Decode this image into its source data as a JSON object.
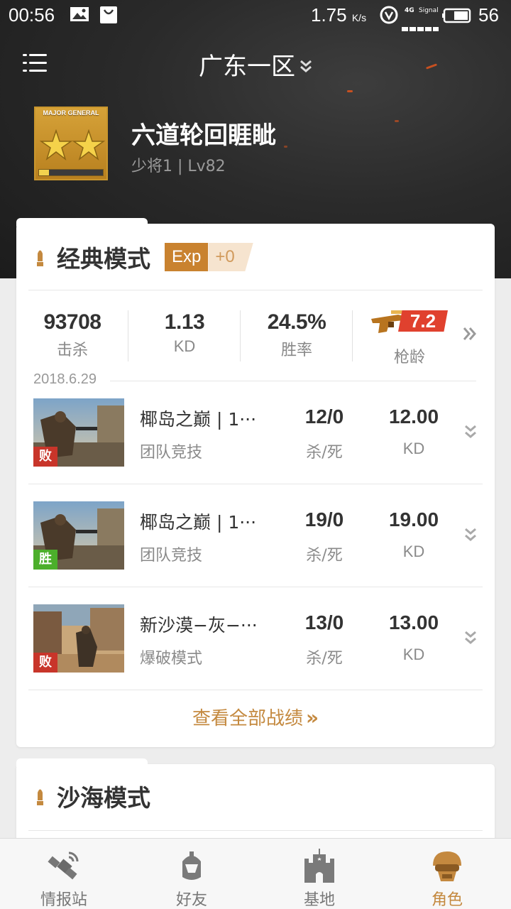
{
  "status_bar": {
    "time": "00:56",
    "net_speed": "1.75",
    "net_speed_unit": "K/s",
    "network_type": "4G",
    "signal_label": "Signal",
    "battery": "56"
  },
  "header": {
    "server": "广东一区",
    "rank_badge_text": "MAJOR GENERAL",
    "rank_progress": 0.15,
    "player_name": "六道轮回睚眦",
    "player_level": "少将1 | Lv82"
  },
  "classic_mode": {
    "title": "经典模式",
    "exp_label": "Exp",
    "exp_value": "+0",
    "stats": [
      {
        "value": "93708",
        "label": "击杀"
      },
      {
        "value": "1.13",
        "label": "KD"
      },
      {
        "value": "24.5%",
        "label": "胜率"
      }
    ],
    "gun_age": {
      "value": "7.2",
      "label": "枪龄"
    },
    "date": "2018.6.29",
    "matches": [
      {
        "map": "椰岛之巅 | 1···",
        "mode": "团队竞技",
        "result": "败",
        "result_type": "lose",
        "kills_deaths": "12/0",
        "kd_label": "杀/死",
        "kd": "12.00",
        "kd_unit": "KD"
      },
      {
        "map": "椰岛之巅 | 1···",
        "mode": "团队竞技",
        "result": "胜",
        "result_type": "win",
        "kills_deaths": "19/0",
        "kd_label": "杀/死",
        "kd": "19.00",
        "kd_unit": "KD"
      },
      {
        "map": "新沙漠−灰−···",
        "mode": "爆破模式",
        "result": "败",
        "result_type": "lose",
        "kills_deaths": "13/0",
        "kd_label": "杀/死",
        "kd": "13.00",
        "kd_unit": "KD"
      }
    ],
    "view_all": "查看全部战绩",
    "view_all_arrow": "»"
  },
  "sand_mode": {
    "title": "沙海模式"
  },
  "tabbar": {
    "tabs": [
      {
        "label": "情报站",
        "icon": "satellite-icon"
      },
      {
        "label": "好友",
        "icon": "soldier-helmet-icon"
      },
      {
        "label": "基地",
        "icon": "castle-icon"
      },
      {
        "label": "角色",
        "icon": "helmet-mask-icon"
      }
    ],
    "active_index": 3
  },
  "colors": {
    "accent": "#c4893f",
    "lose": "#c8352a",
    "win": "#4caf2b",
    "gun_ribbon": "#e0412e"
  }
}
